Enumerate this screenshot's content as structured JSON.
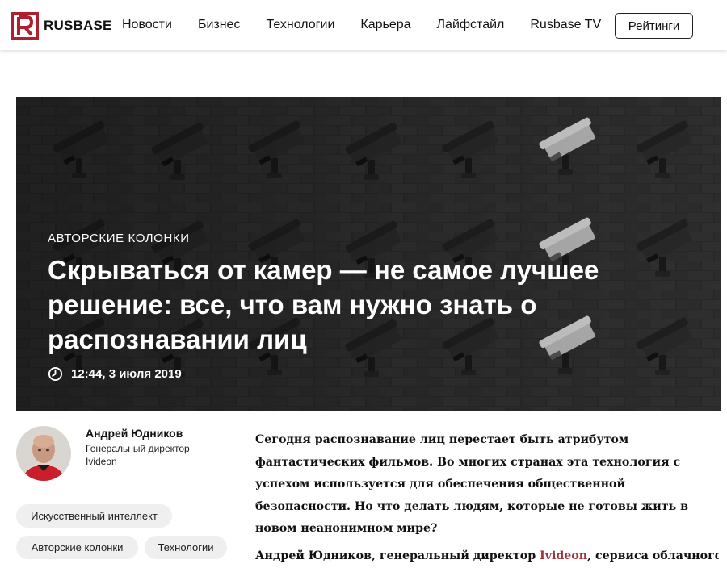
{
  "header": {
    "logo_text": "RUSBASE",
    "nav": [
      "Новости",
      "Бизнес",
      "Технологии",
      "Карьера",
      "Лайфстайл",
      "Rusbase TV"
    ],
    "ratings_button": "Рейтинги",
    "brand_color": "#b01f2e"
  },
  "hero": {
    "category": "Авторские колонки",
    "title": "Скрываться от камер — не самое лучшее решение: все, что вам нужно знать о распознавании лиц",
    "time": "12:44, 3 июля 2019",
    "time_icon": "clock-icon",
    "image_alt": "security-cameras-on-brick-wall"
  },
  "author": {
    "name": "Андрей Юдников",
    "role": "Генеральный директор Ivideon"
  },
  "tags": [
    "Искусственный интеллект",
    "Авторские колонки",
    "Технологии"
  ],
  "article": {
    "lead": "Сегодня распознавание лиц перестает быть атрибутом фантастических фильмов. Во многих странах эта технология с успехом используется для обеспечения общественной безопасности. Но что делать людям, которые не готовы жить в новом неанонимном мире?",
    "para2_before": "Андрей Юдников, генеральный директор ",
    "para2_link": "Ivideon",
    "para2_after": ", сервиса облачного",
    "link_color": "#a2313b"
  }
}
